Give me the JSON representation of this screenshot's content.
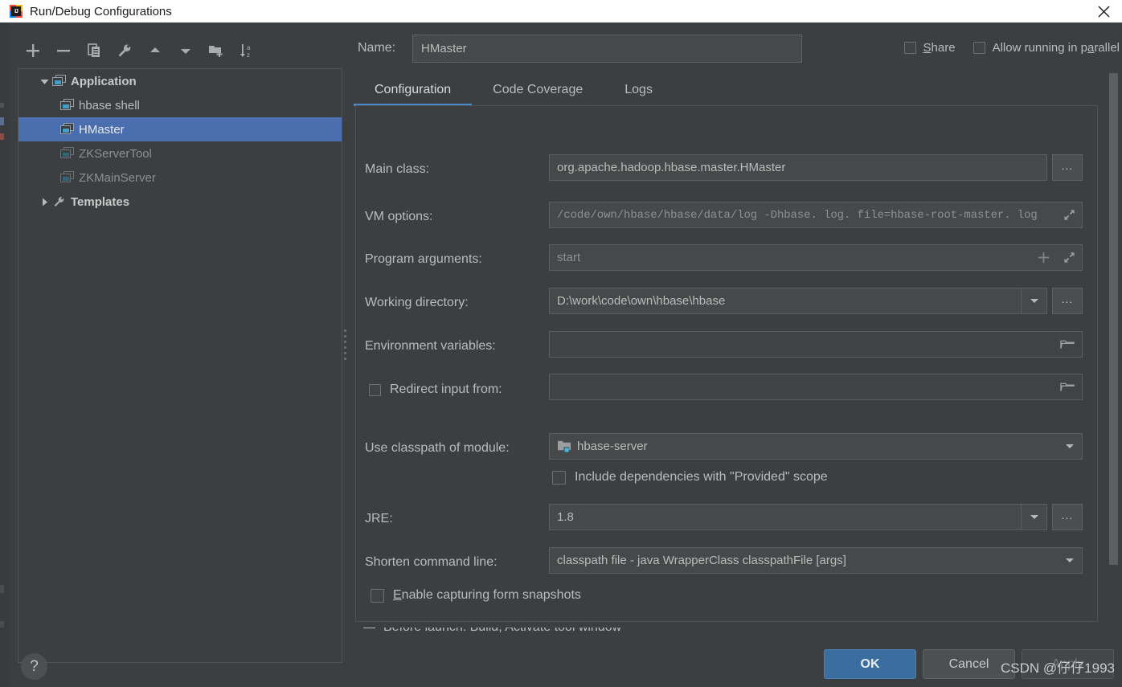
{
  "window": {
    "title": "Run/Debug Configurations",
    "close_icon": "close-icon",
    "app_icon": "intellij-idea-icon"
  },
  "toolbar": {
    "buttons": [
      {
        "name": "add",
        "icon": "plus-icon"
      },
      {
        "name": "remove",
        "icon": "minus-icon"
      },
      {
        "name": "copy",
        "icon": "copy-icon"
      },
      {
        "name": "edit-templates",
        "icon": "wrench-icon"
      },
      {
        "name": "move-up",
        "icon": "arrow-up-icon"
      },
      {
        "name": "move-down",
        "icon": "arrow-down-icon"
      },
      {
        "name": "new-folder",
        "icon": "new-folder-icon"
      },
      {
        "name": "sort-alphabetically",
        "icon": "sort-az-icon"
      }
    ]
  },
  "tree": {
    "nodes": [
      {
        "label": "Application",
        "level": 0,
        "expanded": true,
        "icon": "application-icon",
        "selected": false,
        "dim": false,
        "bold": true
      },
      {
        "label": "hbase shell",
        "level": 1,
        "icon": "application-icon",
        "selected": false,
        "dim": false,
        "bold": false
      },
      {
        "label": "HMaster",
        "level": 1,
        "icon": "application-icon",
        "selected": true,
        "dim": false,
        "bold": false
      },
      {
        "label": "ZKServerTool",
        "level": 1,
        "icon": "application-icon",
        "selected": false,
        "dim": true,
        "bold": false
      },
      {
        "label": "ZKMainServer",
        "level": 1,
        "icon": "application-icon",
        "selected": false,
        "dim": true,
        "bold": false
      },
      {
        "label": "Templates",
        "level": 0,
        "expanded": false,
        "icon": "wrench-icon",
        "selected": false,
        "dim": false,
        "bold": true
      }
    ]
  },
  "header": {
    "name_label": "Name:",
    "name_value": "HMaster",
    "share_label": "Share",
    "share_mnemonic": "S",
    "share_checked": false,
    "parallel_label": "Allow running in parallel",
    "parallel_mnemonic": "a",
    "parallel_checked": false
  },
  "tabs": [
    {
      "label": "Configuration",
      "active": true
    },
    {
      "label": "Code Coverage",
      "active": false
    },
    {
      "label": "Logs",
      "active": false
    }
  ],
  "form": {
    "main_class": {
      "label": "Main class:",
      "value": "org.apache.hadoop.hbase.master.HMaster",
      "browse_label": "..."
    },
    "vm_options": {
      "label": "VM options:",
      "value": "/code/own/hbase/hbase/data/log -Dhbase. log. file=hbase-root-master. log",
      "expand_icon": "expand-icon"
    },
    "program_arguments": {
      "label": "Program arguments:",
      "value": "start",
      "add_icon": "plus-icon",
      "expand_icon": "expand-icon"
    },
    "working_directory": {
      "label": "Working directory:",
      "value": "D:\\work\\code\\own\\hbase\\hbase",
      "dropdown_icon": "chevron-down-icon",
      "browse_label": "..."
    },
    "environment_variables": {
      "label": "Environment variables:",
      "value": "",
      "browse_icon": "folder-icon"
    },
    "redirect_input": {
      "label": "Redirect input from:",
      "checked": false,
      "value": "",
      "browse_icon": "folder-icon"
    },
    "classpath_module": {
      "label": "Use classpath of module:",
      "value": "hbase-server",
      "module_icon": "module-folder-icon",
      "dropdown_icon": "chevron-down-icon"
    },
    "include_provided": {
      "label": "Include dependencies with \"Provided\" scope",
      "checked": false
    },
    "jre": {
      "label": "JRE:",
      "value": "1.8",
      "dropdown_icon": "chevron-down-icon",
      "browse_label": "..."
    },
    "shorten_command_line": {
      "label": "Shorten command line:",
      "value": "classpath file - java WrapperClass classpathFile [args]",
      "dropdown_icon": "chevron-down-icon"
    },
    "form_snapshots": {
      "label": "Enable capturing form snapshots",
      "mnemonic": "E",
      "checked": false
    }
  },
  "before_launch": {
    "label": "Before launch: Build, Activate tool window"
  },
  "footer": {
    "help_label": "?",
    "ok_label": "OK",
    "cancel_label": "Cancel",
    "apply_label": "Apply",
    "watermark": "CSDN @仔仔1993"
  },
  "colors": {
    "accent": "#4b6eaf",
    "tab_underline": "#4a88c7",
    "panel_bg": "#3c3f41",
    "field_bg": "#45494a",
    "titlebar_bg": "#ffffff"
  }
}
